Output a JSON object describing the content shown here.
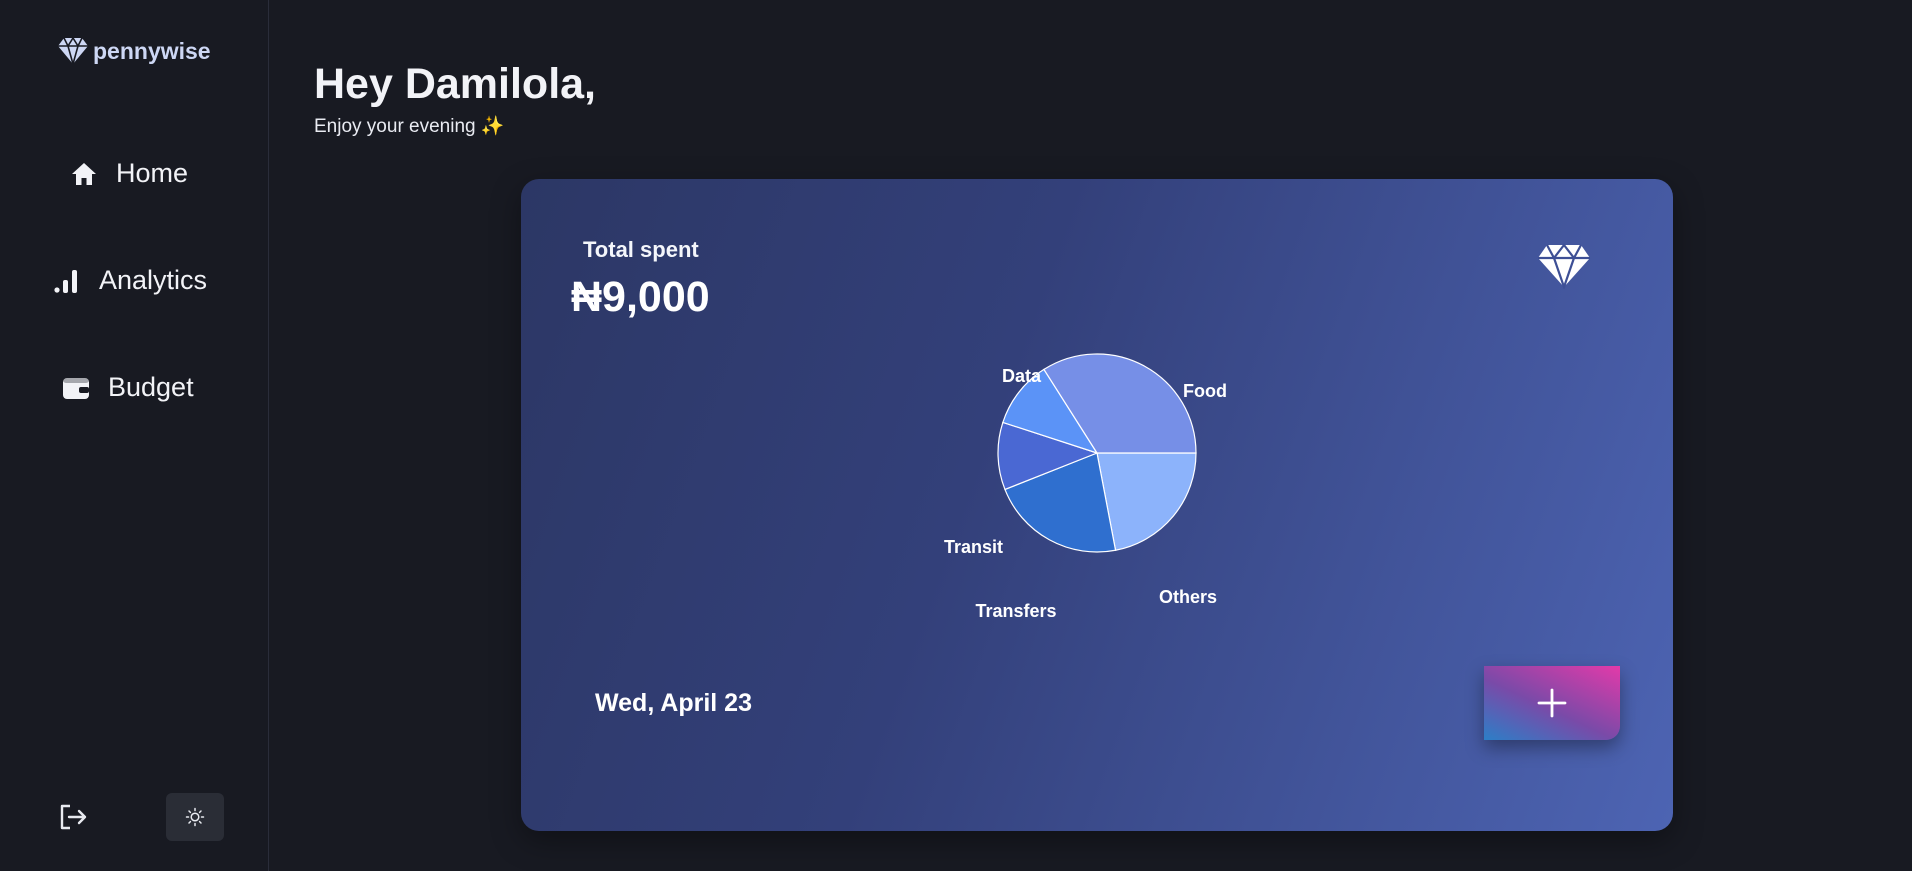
{
  "brand": {
    "name": "pennywise"
  },
  "sidebar": {
    "items": [
      {
        "label": "Home",
        "icon": "home-icon"
      },
      {
        "label": "Analytics",
        "icon": "bar-chart-icon"
      },
      {
        "label": "Budget",
        "icon": "wallet-icon"
      }
    ],
    "logout_icon": "logout-icon",
    "theme_icon": "sun-icon"
  },
  "header": {
    "greeting": "Hey Damilola,",
    "subtitle": "Enjoy your evening ✨"
  },
  "card": {
    "total_label": "Total spent",
    "total_amount": "₦9,000",
    "date": "Wed, April 23",
    "add_label": "+"
  },
  "colors": {
    "accent": "#4d64b3",
    "food": "#8cb3fb",
    "others": "#2f6fcf",
    "transfers": "#4a68d3",
    "transit": "#5b93f7",
    "data": "#768fe7"
  },
  "chart_data": {
    "type": "pie",
    "categories": [
      "Food",
      "Others",
      "Transfers",
      "Transit",
      "Data"
    ],
    "values": [
      22,
      22,
      11,
      11,
      34
    ]
  }
}
